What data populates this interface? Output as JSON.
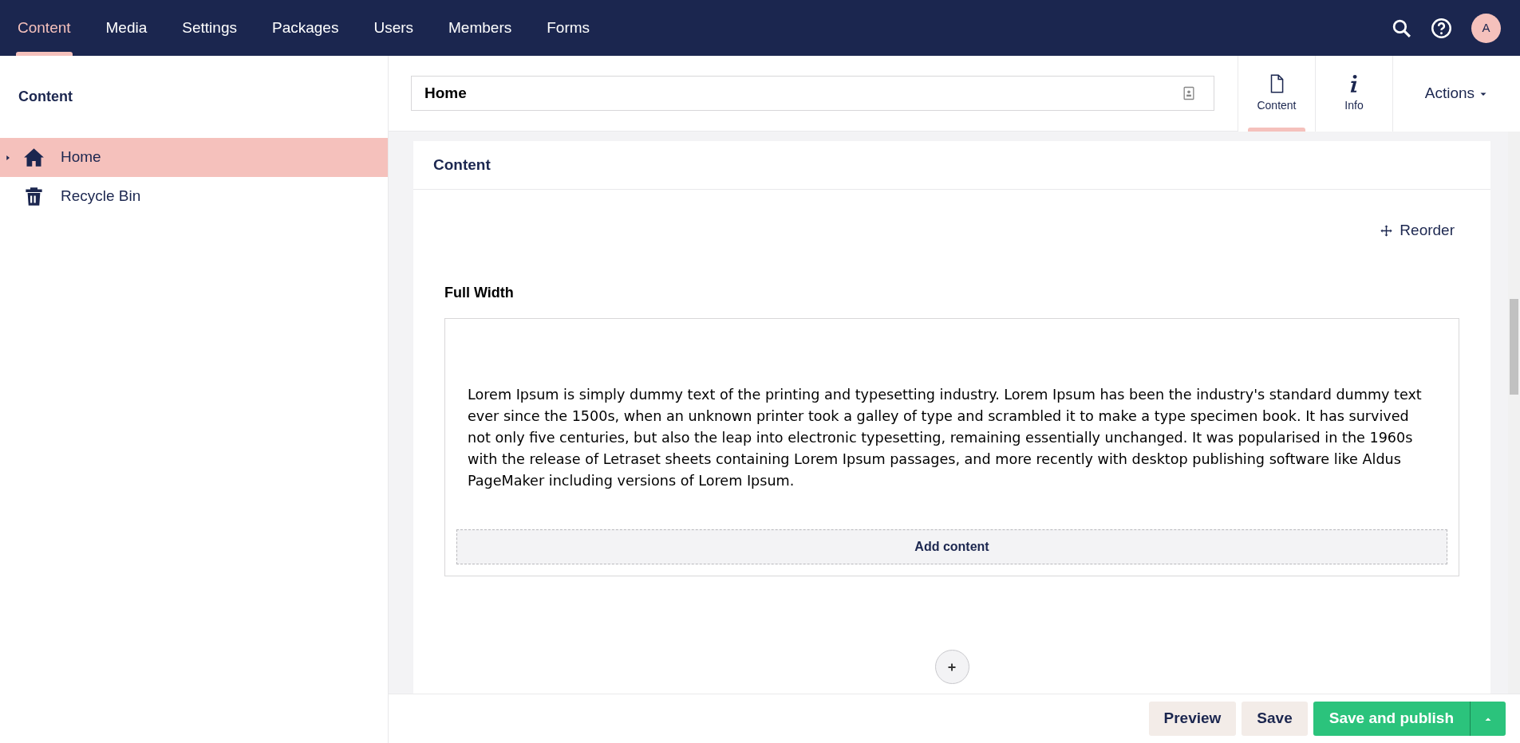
{
  "top_nav": {
    "sections": [
      {
        "label": "Content",
        "selected": true
      },
      {
        "label": "Media",
        "selected": false
      },
      {
        "label": "Settings",
        "selected": false
      },
      {
        "label": "Packages",
        "selected": false
      },
      {
        "label": "Users",
        "selected": false
      },
      {
        "label": "Members",
        "selected": false
      },
      {
        "label": "Forms",
        "selected": false
      }
    ],
    "avatar": "A"
  },
  "sidebar": {
    "title": "Content",
    "items": [
      {
        "label": "Home",
        "kind": "home",
        "selected": true,
        "has_children": true
      },
      {
        "label": "Recycle Bin",
        "kind": "trash",
        "selected": false,
        "has_children": false
      }
    ]
  },
  "editor": {
    "name_value": "Home",
    "apps": [
      {
        "label": "Content",
        "kind": "document",
        "selected": true
      },
      {
        "label": "Info",
        "kind": "info",
        "selected": false
      }
    ],
    "actions": "Actions",
    "panel_title": "Content",
    "reorder": "Reorder",
    "section_title": "Full Width",
    "body_text": "Lorem Ipsum is simply dummy text of the printing and typesetting industry. Lorem Ipsum has been the industry's standard dummy text ever since the 1500s, when an unknown printer took a galley of type and scrambled it to make a type specimen book. It has survived not only five centuries, but also the leap into electronic typesetting, remaining essentially unchanged. It was popularised in the 1960s with the release of Letraset sheets containing Lorem Ipsum passages, and more recently with desktop publishing software like Aldus PageMaker including versions of Lorem Ipsum.",
    "add_content": "Add content"
  },
  "footer": {
    "buttons": [
      {
        "label": "Preview",
        "kind": "plain"
      },
      {
        "label": "Save",
        "kind": "plain"
      },
      {
        "label": "Save and publish",
        "kind": "primary"
      }
    ]
  }
}
